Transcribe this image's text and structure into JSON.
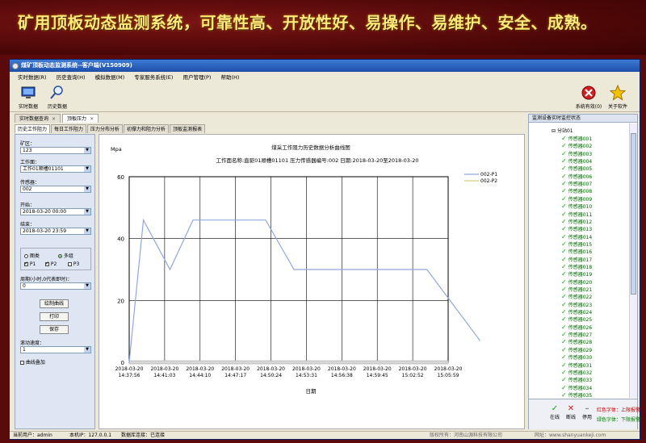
{
  "banner": {
    "text": "矿用顶板动态监测系统，可靠性高、开放性好、易操作、易维护、安全、成熟。"
  },
  "window": {
    "title": "煤矿顶板动态监测系统--客户端(V150909)"
  },
  "menu": [
    "实时数据(R)",
    "历史查询(H)",
    "模拟数据(M)",
    "专家服务系统(E)",
    "用户管理(P)",
    "帮助(H)"
  ],
  "toolbar": {
    "realtime_label": "实时数据",
    "history_label": "历史数据",
    "exit_label": "系统有效(0)",
    "about_label": "关于软件"
  },
  "doc_tabs": [
    {
      "label": "实时数据查询",
      "closable": true
    },
    {
      "label": "顶板压力",
      "closable": true
    }
  ],
  "sub_tabs": [
    "历史工作阻力",
    "每日工作阻力",
    "压力分布分析",
    "初撑力和阻力分析",
    "顶板监测报表"
  ],
  "left": {
    "mine_label": "矿区：",
    "mine_value": "123",
    "face_label": "工作面：",
    "face_value": "工作01顺槽01101",
    "sensor_label": "传感器：",
    "sensor_value": "002",
    "start_label": "开始：",
    "start_value": "2018-03-20 00:00",
    "end_label": "结束：",
    "end_value": "2018-03-20 23:59",
    "opt_single": "图类",
    "opt_multi": "多组",
    "chk_a": "P1",
    "chk_b": "P2",
    "chk_c": "P3",
    "period_label": "周期(小时,0代表即时)：",
    "period_value": "0",
    "draw_button": "绘制曲线",
    "print_button": "打印",
    "save_button": "保存",
    "speed_label": "滚动速度：",
    "speed_value": "1",
    "overlay_label": "曲线叠加"
  },
  "chart_data": {
    "type": "line",
    "title": "煤采工作阻力历史数据分析曲线图",
    "subtitle": "工作面名称:直驱01顺槽01101  压力传感器编号:002  日期:2018-03-20至2018-03-20",
    "ylabel": "Mpa",
    "xlabel": "日期",
    "ylim": [
      0,
      60
    ],
    "yticks": [
      0,
      20,
      40,
      60
    ],
    "grid": true,
    "legend_position": "top-right",
    "x": [
      "2018-03-20 14:37:56",
      "2018-03-20 14:41:03",
      "2018-03-20 14:44:10",
      "2018-03-20 14:47:17",
      "2018-03-20 14:50:24",
      "2018-03-20 14:53:31",
      "2018-03-20 14:56:38",
      "2018-03-20 14:59:45",
      "2018-03-20 15:02:52",
      "2018-03-20 15:05:59"
    ],
    "series": [
      {
        "name": "002-P1",
        "color": "#8fa8dc",
        "points": [
          [
            0,
            0
          ],
          [
            0.4,
            46
          ],
          [
            1.15,
            30
          ],
          [
            1.8,
            46
          ],
          [
            2.6,
            46
          ],
          [
            3.85,
            46
          ],
          [
            4.65,
            30
          ],
          [
            7.0,
            30
          ],
          [
            8.4,
            30
          ],
          [
            9.9,
            7
          ]
        ]
      },
      {
        "name": "002-P2",
        "color": "#d8cf7a",
        "points": []
      }
    ]
  },
  "right": {
    "title": "监测设备实时监控状态",
    "root_label": "分站01",
    "sensors": [
      "传感器001",
      "传感器002",
      "传感器003",
      "传感器004",
      "传感器005",
      "传感器006",
      "传感器007",
      "传感器008",
      "传感器009",
      "传感器010",
      "传感器011",
      "传感器012",
      "传感器013",
      "传感器014",
      "传感器015",
      "传感器016",
      "传感器017",
      "传感器018",
      "传感器019",
      "传感器020",
      "传感器021",
      "传感器022",
      "传感器023",
      "传感器024",
      "传感器025",
      "传感器026",
      "传感器027",
      "传感器028",
      "传感器029",
      "传感器030",
      "传感器031",
      "传感器032",
      "传感器033",
      "传感器034",
      "传感器035"
    ],
    "legend": {
      "normal_label": "在线",
      "offline_label": "断线",
      "stop_label": "停用",
      "red_text": "红色字体：上限报警",
      "green_text": "绿色字体：下限报警"
    }
  },
  "status": {
    "user": "当前用户：admin",
    "ip": "本机IP：127.0.0.1",
    "db": "数据库连接：已连接",
    "company": "版权所有：河南山源科技有限公司",
    "website": "网址：www.shanyuankeji.com"
  }
}
